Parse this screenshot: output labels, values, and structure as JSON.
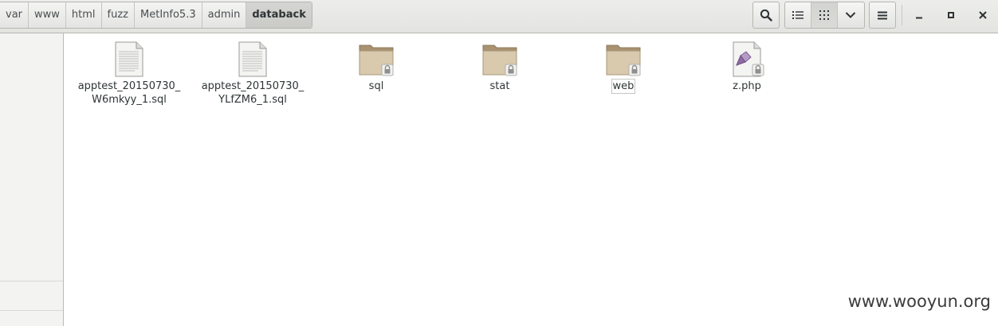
{
  "breadcrumbs": [
    "var",
    "www",
    "html",
    "fuzz",
    "MetInfo5.3",
    "admin",
    "databack"
  ],
  "active_crumb": "databack",
  "toolbar": {
    "search": "search-icon",
    "list_view": "list-view-icon",
    "grid_view": "grid-view-icon",
    "view_options": "chevron-down-icon",
    "menu": "hamburger-menu-icon"
  },
  "window": {
    "minimize": "minimize-icon",
    "maximize": "maximize-icon",
    "close": "close-icon"
  },
  "files": [
    {
      "line1": "apptest_20150730_",
      "line2": "W6mkyy_1.sql",
      "type": "text-document"
    },
    {
      "line1": "apptest_20150730_",
      "line2": "YLfZM6_1.sql",
      "type": "text-document"
    },
    {
      "line1": "sql",
      "line2": "",
      "type": "locked-folder"
    },
    {
      "line1": "stat",
      "line2": "",
      "type": "locked-folder"
    },
    {
      "line1": "web",
      "line2": "",
      "type": "locked-folder"
    },
    {
      "line1": "z.php",
      "line2": "",
      "type": "locked-php-script"
    }
  ],
  "watermark": "www.wooyun.org",
  "colors": {
    "folder": "#c8b79c",
    "lock": "#8f8f8f",
    "active_crumb_bg": "#cdcdca"
  }
}
